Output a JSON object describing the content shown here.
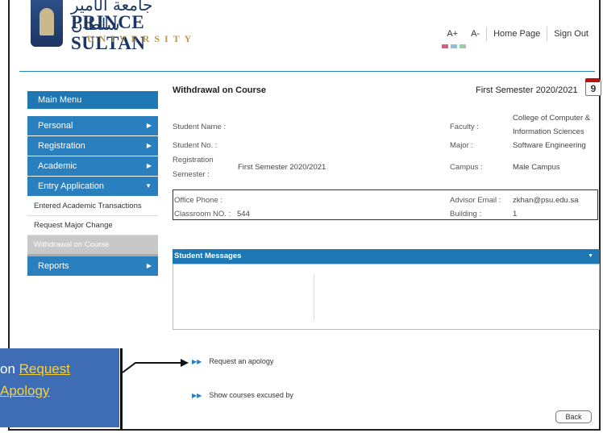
{
  "header": {
    "logo_arabic": "جامعة الأمير سلطان",
    "logo_name": "PRINCE SULTAN",
    "logo_university": "UNIVERSITY",
    "font_increase": "A+",
    "font_decrease": "A-",
    "home_page": "Home Page",
    "sign_out": "Sign Out"
  },
  "sidebar": {
    "main_menu": "Main Menu",
    "items": [
      {
        "label": "Personal"
      },
      {
        "label": "Registration"
      },
      {
        "label": "Academic"
      },
      {
        "label": "Entry Application"
      }
    ],
    "sub_items": [
      {
        "label": "Entered Academic Transactions"
      },
      {
        "label": "Request Major Change"
      },
      {
        "label": "Withdrawal on Course"
      }
    ],
    "reports": "Reports"
  },
  "main": {
    "title": "Withdrawal on Course",
    "semester": "First Semester 2020/2021",
    "calendar_day": "9",
    "student_name_label": "Student Name :",
    "student_no_label": "Student No. :",
    "registration_label": "Registration",
    "semester_label": "Semester :",
    "registration_semester_value": "First Semester 2020/2021",
    "faculty_label": "Faculty :",
    "faculty_value_1": "College of Computer &",
    "faculty_value_2": "Information Sciences",
    "major_label": "Major :",
    "major_value": "Software Engineering",
    "campus_label": "Campus :",
    "campus_value": "Male Campus",
    "office_phone_label": "Office Phone :",
    "classroom_label": "Classroom NO. :",
    "classroom_value": "544",
    "advisor_email_label": "Advisor Email :",
    "advisor_email_value": "zkhan@psu.edu.sa",
    "building_label": "Building :",
    "building_value": "1",
    "student_messages": "Student Messages",
    "request_apology": "Request an apology",
    "show_courses": "Show courses excused by",
    "back": "Back"
  },
  "callout": {
    "line1_prefix": "on ",
    "line1_link": "Request",
    "line2_link": "Apology"
  },
  "colors": {
    "accent": "#1f77b4",
    "callout_bg": "#3f6db5",
    "link_yellow": "#f4d13a"
  }
}
